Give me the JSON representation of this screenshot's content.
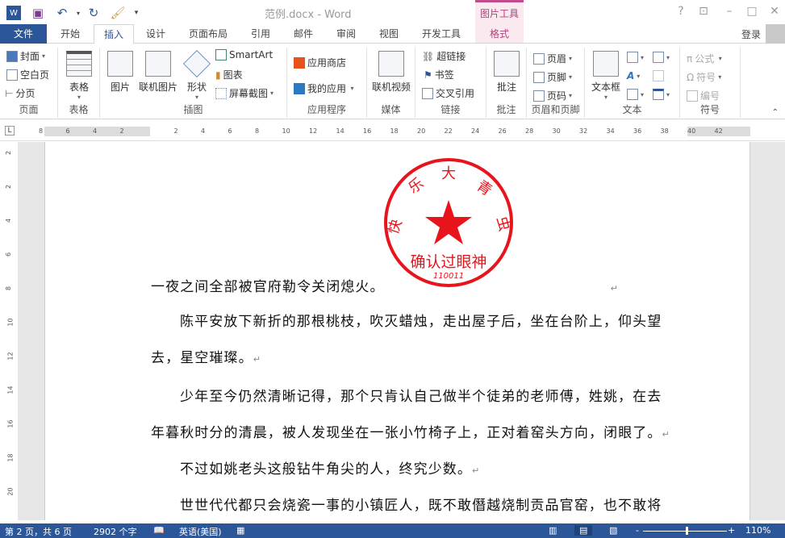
{
  "title_bar": {
    "document_title": "范例.docx - Word",
    "contextual_tab_group": "图片工具",
    "buttons": [
      "?",
      "restore-ribbon",
      "minimize",
      "maximize",
      "close"
    ]
  },
  "tabs": {
    "file": "文件",
    "items": [
      "开始",
      "插入",
      "设计",
      "页面布局",
      "引用",
      "邮件",
      "审阅",
      "视图",
      "开发工具"
    ],
    "active": "插入",
    "format": "格式",
    "login": "登录"
  },
  "ribbon": {
    "pages": {
      "label": "页面",
      "items": [
        "封面",
        "空白页",
        "分页"
      ]
    },
    "tables": {
      "label": "表格",
      "table": "表格"
    },
    "illustrations": {
      "label": "插图",
      "picture": "图片",
      "online_picture": "联机图片",
      "shapes": "形状",
      "smartart": "SmartArt",
      "chart": "图表",
      "screenshot": "屏幕截图"
    },
    "apps": {
      "label": "应用程序",
      "store": "应用商店",
      "my_apps": "我的应用"
    },
    "media": {
      "label": "媒体",
      "online_video": "联机视频"
    },
    "links": {
      "label": "链接",
      "hyperlink": "超链接",
      "bookmark": "书签",
      "cross_ref": "交叉引用"
    },
    "comments": {
      "label": "批注",
      "comment": "批注"
    },
    "header_footer": {
      "label": "页眉和页脚",
      "header": "页眉",
      "footer": "页脚",
      "page_number": "页码"
    },
    "text": {
      "label": "文本",
      "textbox": "文本框"
    },
    "symbols": {
      "label": "符号",
      "equation": "公式",
      "symbol": "符号",
      "numbering": "编号"
    }
  },
  "ruler": {
    "horizontal": [
      "8",
      "6",
      "4",
      "2",
      "2",
      "4",
      "6",
      "8",
      "10",
      "12",
      "14",
      "16",
      "18",
      "20",
      "22",
      "24",
      "26",
      "28",
      "30",
      "32",
      "34",
      "36",
      "38",
      "40",
      "42"
    ],
    "vertical": [
      "2",
      "2",
      "4",
      "6",
      "8",
      "10",
      "12",
      "14",
      "16",
      "18",
      "20"
    ]
  },
  "seal": {
    "arc_text": [
      "快",
      "乐",
      "大",
      "青",
      "虫"
    ],
    "bottom_text": "确认过眼神",
    "number": "110011",
    "color": "#e8141c"
  },
  "document": {
    "lines": [
      "一夜之间全部被官府勒令关闭熄火。",
      "陈平安放下新折的那根桃枝，吹灭蜡烛，走出屋子后，坐在台阶上，仰头望",
      "去，星空璀璨。",
      "少年至今仍然清晰记得，那个只肯认自己做半个徒弟的老师傅，姓姚，在去",
      "年暮秋时分的清晨，被人发现坐在一张小竹椅子上，正对着窑头方向，闭眼了。",
      "不过如姚老头这般钻牛角尖的人，终究少数。",
      "世世代代都只会烧瓷一事的小镇匠人，既不敢僭越烧制贡品官窑，也不敢将"
    ],
    "paragraph_mark": "↵"
  },
  "status": {
    "page": "第 2 页，共 6 页",
    "words": "2902 个字",
    "language": "英语(美国)",
    "zoom": "110%",
    "zoom_level": 110
  },
  "colors": {
    "accent": "#2b579a",
    "picture_tools": "#b0407e"
  }
}
